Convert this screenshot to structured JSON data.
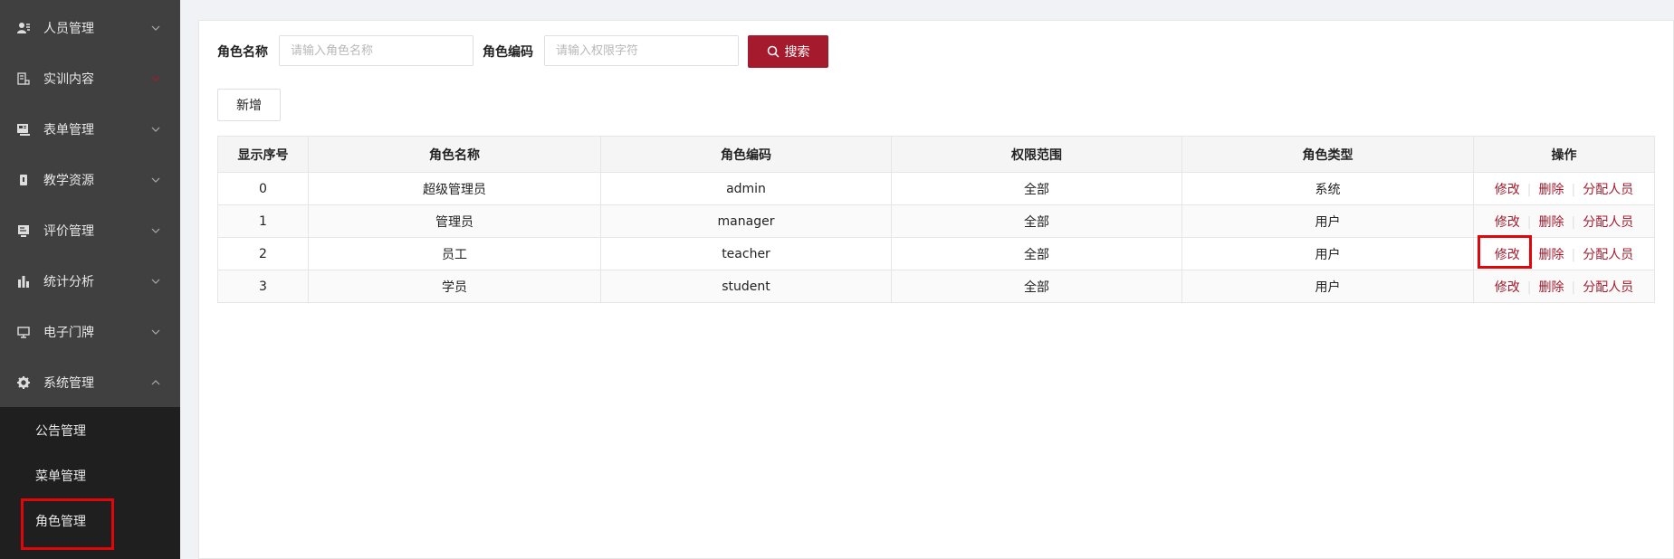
{
  "sidebar": {
    "items": [
      {
        "label": "人员管理",
        "icon": "user-icon",
        "arrow": "chevron-down"
      },
      {
        "label": "实训内容",
        "icon": "training-icon",
        "arrow": "chevron-down"
      },
      {
        "label": "表单管理",
        "icon": "form-icon",
        "arrow": "chevron-down"
      },
      {
        "label": "教学资源",
        "icon": "resource-icon",
        "arrow": "chevron-down"
      },
      {
        "label": "评价管理",
        "icon": "evaluation-icon",
        "arrow": "chevron-down"
      },
      {
        "label": "统计分析",
        "icon": "bar-chart-icon",
        "arrow": "chevron-down"
      },
      {
        "label": "电子门牌",
        "icon": "monitor-icon",
        "arrow": "chevron-down"
      },
      {
        "label": "系统管理",
        "icon": "gear-icon",
        "arrow": "chevron-up"
      }
    ],
    "submenu": [
      {
        "label": "公告管理"
      },
      {
        "label": "菜单管理"
      },
      {
        "label": "角色管理"
      }
    ]
  },
  "search": {
    "role_name_label": "角色名称",
    "role_name_placeholder": "请输入角色名称",
    "role_code_label": "角色编码",
    "role_code_placeholder": "请输入权限字符",
    "search_button": "搜索"
  },
  "toolbar": {
    "add_button": "新增"
  },
  "table": {
    "headers": [
      "显示序号",
      "角色名称",
      "角色编码",
      "权限范围",
      "角色类型",
      "操作"
    ],
    "rows": [
      {
        "order": "0",
        "name": "超级管理员",
        "code": "admin",
        "scope": "全部",
        "type": "系统"
      },
      {
        "order": "1",
        "name": "管理员",
        "code": "manager",
        "scope": "全部",
        "type": "用户"
      },
      {
        "order": "2",
        "name": "员工",
        "code": "teacher",
        "scope": "全部",
        "type": "用户"
      },
      {
        "order": "3",
        "name": "学员",
        "code": "student",
        "scope": "全部",
        "type": "用户"
      }
    ],
    "actions": {
      "edit": "修改",
      "delete": "删除",
      "assign": "分配人员"
    }
  },
  "colors": {
    "accent": "#a51b2d",
    "sidebar_bg": "#404040",
    "submenu_bg": "#1f1f1f",
    "highlight": "#e0060a"
  }
}
